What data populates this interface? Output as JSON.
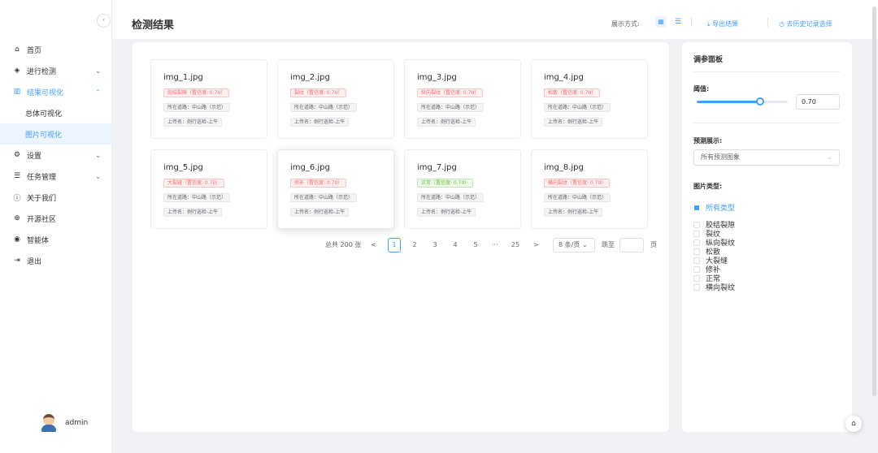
{
  "sidebar": {
    "collapse_glyph": "‹",
    "items": [
      {
        "label": "首页",
        "icon": "home-icon",
        "glyph": "⌂",
        "arrow": ""
      },
      {
        "label": "进行检测",
        "icon": "cube-icon",
        "glyph": "◈",
        "arrow": "⌄"
      },
      {
        "label": "结果可视化",
        "icon": "chart-icon",
        "glyph": "▥",
        "arrow": "⌃",
        "active": true
      },
      {
        "label": "设置",
        "icon": "settings-icon",
        "glyph": "⚙",
        "arrow": "⌄"
      },
      {
        "label": "任务管理",
        "icon": "task-icon",
        "glyph": "☰",
        "arrow": "⌄"
      },
      {
        "label": "关于我们",
        "icon": "info-icon",
        "glyph": "ⓘ",
        "arrow": ""
      },
      {
        "label": "开源社区",
        "icon": "globe-icon",
        "glyph": "⊕",
        "arrow": ""
      },
      {
        "label": "智能体",
        "icon": "robot-icon",
        "glyph": "◉",
        "arrow": ""
      },
      {
        "label": "退出",
        "icon": "logout-icon",
        "glyph": "⇥",
        "arrow": ""
      }
    ],
    "sub_items": [
      {
        "label": "总体可视化"
      },
      {
        "label": "图片可视化",
        "current": true
      }
    ],
    "user": {
      "name": "admin"
    }
  },
  "header": {
    "title": "检测结果",
    "display_mode_label": "展示方式:",
    "grid_glyph": "▦",
    "list_glyph": "☰",
    "export_label": "⤓ 导出结果",
    "history_label": "◷ 去历史记录选择"
  },
  "cards": [
    {
      "name": "img_1.jpg",
      "tag": "胶结裂隙（置信度: 0.70）",
      "tag_color": "red",
      "road": "所在道路：中山路（示范）",
      "uploader": "上传名：例行巡检-上午"
    },
    {
      "name": "img_2.jpg",
      "tag": "裂纹（置信度: 0.70）",
      "tag_color": "red",
      "road": "所在道路：中山路（示范）",
      "uploader": "上传名：例行巡检-上午"
    },
    {
      "name": "img_3.jpg",
      "tag": "纵向裂纹（置信度: 0.70）",
      "tag_color": "red",
      "road": "所在道路：中山路（示范）",
      "uploader": "上传名：例行巡检-上午"
    },
    {
      "name": "img_4.jpg",
      "tag": "松散（置信度: 0.70）",
      "tag_color": "red",
      "road": "所在道路：中山路（示范）",
      "uploader": "上传名：例行巡检-上午"
    },
    {
      "name": "img_5.jpg",
      "tag": "大裂缝（置信度: 0.70）",
      "tag_color": "red",
      "road": "所在道路：中山路（示范）",
      "uploader": "上传名：例行巡检-上午"
    },
    {
      "name": "img_6.jpg",
      "tag": "修补（置信度: 0.70）",
      "tag_color": "red",
      "road": "所在道路：中山路（示范）",
      "uploader": "上传名：例行巡检-上午",
      "raised": true
    },
    {
      "name": "img_7.jpg",
      "tag": "正常（置信度: 0.70）",
      "tag_color": "green",
      "road": "所在道路：中山路（示范）",
      "uploader": "上传名：例行巡检-上午"
    },
    {
      "name": "img_8.jpg",
      "tag": "横向裂纹（置信度: 0.70）",
      "tag_color": "red",
      "road": "所在道路：中山路（示范）",
      "uploader": "上传名：例行巡检-上午"
    }
  ],
  "pagination": {
    "total": "总共 200 张",
    "prev": "<",
    "pages": [
      "1",
      "2",
      "3",
      "4",
      "5"
    ],
    "current_page": "1",
    "ellipsis": "···",
    "last_page": "25",
    "next": ">",
    "page_size": "8 条/页 ⌄",
    "jump_label": "跳至",
    "jump_value": "",
    "page_unit": "页"
  },
  "panel": {
    "title": "调参面板",
    "threshold_label": "阈值:",
    "threshold_value": "0.70",
    "threshold_fraction": 0.7,
    "predict_label": "预测展示:",
    "predict_value": "所有预测图象",
    "predict_chevron": "⌄",
    "type_label": "图片类型:",
    "types": [
      {
        "label": "所有类型",
        "checked": true
      },
      {
        "label": "胶结裂隙"
      },
      {
        "label": "裂纹"
      },
      {
        "label": "纵向裂纹"
      },
      {
        "label": "松散"
      },
      {
        "label": "大裂缝"
      },
      {
        "label": "修补"
      },
      {
        "label": "正常"
      },
      {
        "label": "横向裂纹"
      }
    ]
  },
  "float_button_glyph": "⌂",
  "colors": {
    "accent": "#409eff",
    "danger": "#f56c6c",
    "success": "#67c23a"
  }
}
